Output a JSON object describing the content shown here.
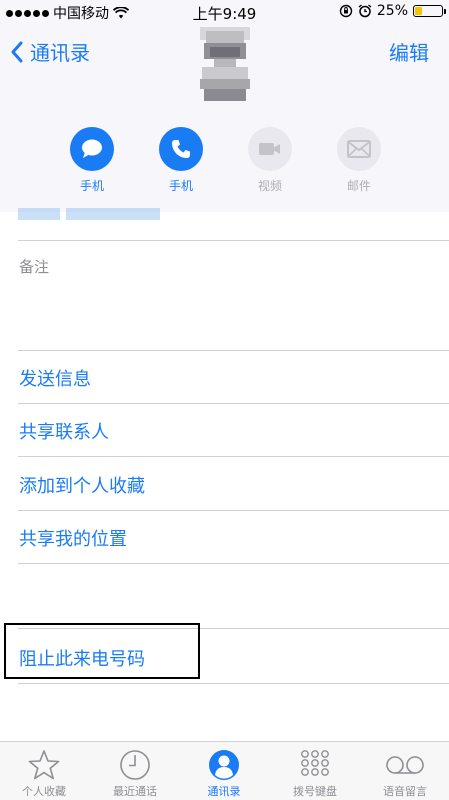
{
  "status_bar": {
    "carrier": "中国移动",
    "time": "上午9:49",
    "battery_percent": "25%",
    "battery_level": 0.25,
    "battery_color": "#f5c400"
  },
  "nav": {
    "back_label": "通讯录",
    "edit_label": "编辑"
  },
  "actions": [
    {
      "label": "手机",
      "icon": "message-icon",
      "enabled": true
    },
    {
      "label": "手机",
      "icon": "phone-icon",
      "enabled": true
    },
    {
      "label": "视频",
      "icon": "video-icon",
      "enabled": false
    },
    {
      "label": "邮件",
      "icon": "mail-icon",
      "enabled": false
    }
  ],
  "notes": {
    "label": "备注"
  },
  "rows": [
    {
      "label": "发送信息"
    },
    {
      "label": "共享联系人"
    },
    {
      "label": "添加到个人收藏"
    },
    {
      "label": "共享我的位置"
    },
    {
      "label": "阻止此来电号码"
    }
  ],
  "tabbar": {
    "items": [
      {
        "label": "个人收藏",
        "icon": "star-icon",
        "active": false
      },
      {
        "label": "最近通话",
        "icon": "clock-icon",
        "active": false
      },
      {
        "label": "通讯录",
        "icon": "contacts-icon",
        "active": true
      },
      {
        "label": "拨号键盘",
        "icon": "keypad-icon",
        "active": false
      },
      {
        "label": "语音留言",
        "icon": "voicemail-icon",
        "active": false
      }
    ]
  },
  "colors": {
    "accent": "#1a7cf5",
    "disabled": "#aeaeb5"
  }
}
